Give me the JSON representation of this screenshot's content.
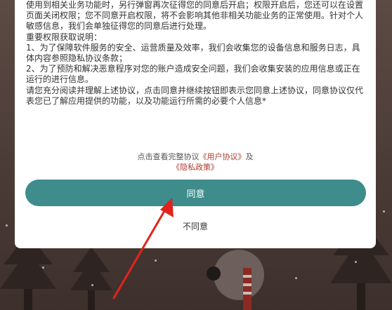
{
  "dialog": {
    "paragraphs": [
      "使用到相关业务功能时，另行弹窗再次征得您的同意后开启；权限开启后，您还可以在设置页面关闭权限；您不同意开启权限，将不会影响其他非相关功能业务的正常使用。针对个人敏感信息，我们会单独征得您的同意后进行处理。",
      "重要权限获取说明：",
      "1、为了保障软件服务的安全、运营质量及效率，我们会收集您的设备信息和服务日志，具体内容参照隐私协议条款；",
      "2、为了预防和解决恶意程序对您的账户造成安全问题，我们会收集安装的应用信息或正在运行的进行信息。",
      "请您充分阅读并理解上述协议，点击同意并继续按钮即表示您同意上述协议，同意协议仅代表您已了解应用提供的功能，以及功能运行所需的必要个人信息*"
    ],
    "links": {
      "prefix": "点击查看完整协议",
      "user_agreement": "《用户协议》",
      "and": "及",
      "privacy_policy": "《隐私政策》"
    },
    "agree_label": "同意",
    "disagree_label": "不同意"
  },
  "colors": {
    "accent": "#3e8c8c",
    "link": "#b03a2e",
    "arrow": "#e0241b"
  }
}
